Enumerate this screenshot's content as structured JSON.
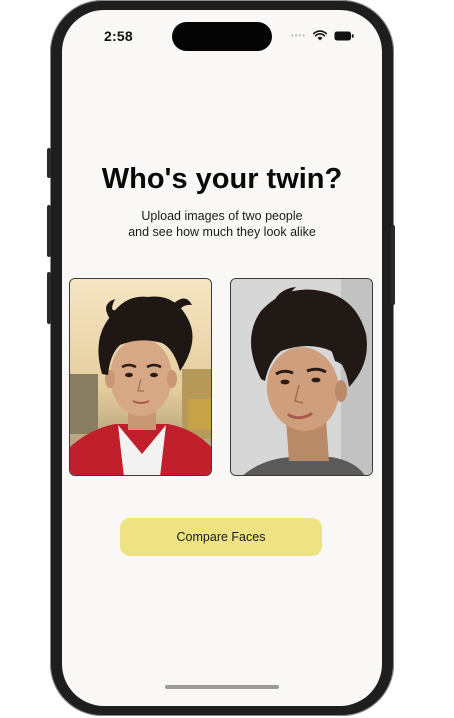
{
  "status_bar": {
    "time": "2:58",
    "signal_icon": "signal-dots-icon",
    "wifi_icon": "wifi-icon",
    "battery_icon": "battery-icon"
  },
  "main": {
    "title": "Who's your twin?",
    "subtitle_line1": "Upload images of two people",
    "subtitle_line2": "and see how much they look alike",
    "photos": [
      {
        "icon": "uploaded-face-photo-1"
      },
      {
        "icon": "uploaded-face-photo-2"
      }
    ],
    "compare_button_label": "Compare Faces"
  },
  "colors": {
    "background": "#f9f8f6",
    "button": "#ede382",
    "phone_frame": "#1e1e1f"
  }
}
